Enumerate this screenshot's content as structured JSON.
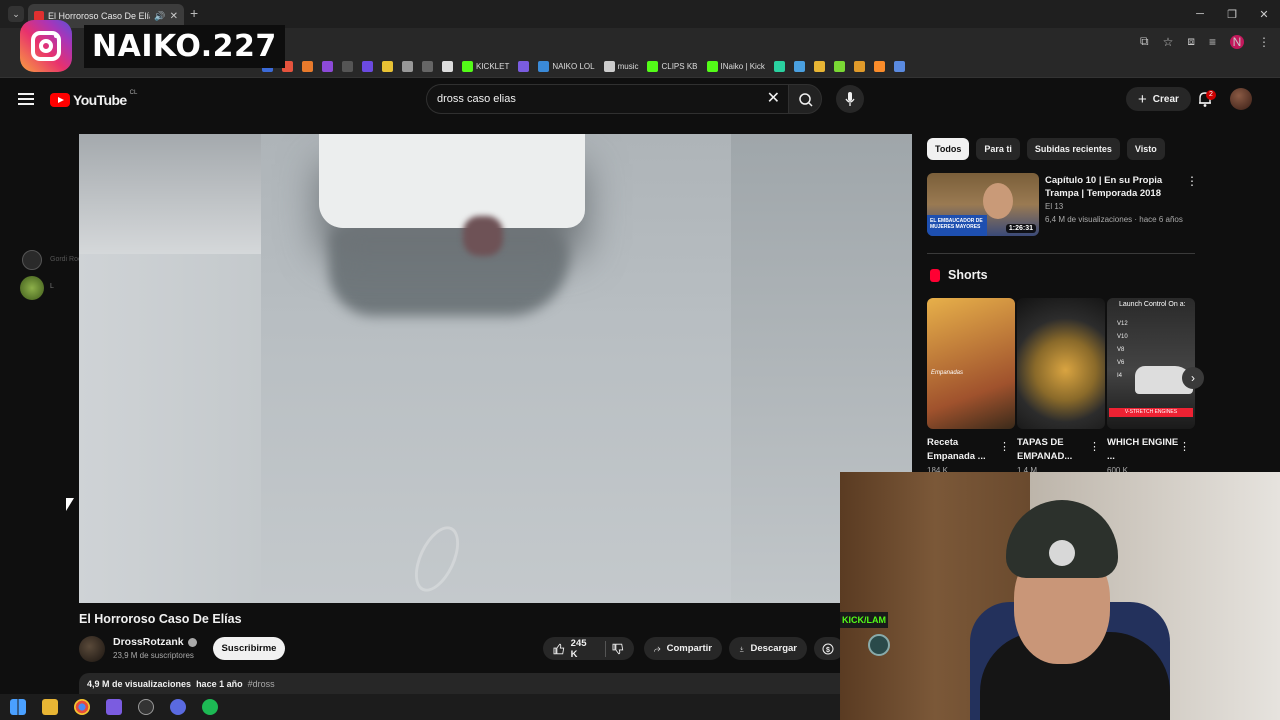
{
  "browser": {
    "tab_title": "El Horroroso Caso De Elías",
    "bookmarks": [
      "KICKLET",
      "NAIKO LOL",
      "music",
      "CLIPS KB",
      "INaiko | Kick"
    ],
    "profile_initial": "N"
  },
  "overlay": {
    "instagram_handle": "NAIKO.227"
  },
  "youtube": {
    "logo_text": "YouTube",
    "country_code": "CL",
    "search_query": "dross caso elias",
    "create_label": "Crear",
    "notifications_count": "2"
  },
  "video": {
    "title": "El Horroroso Caso De Elías",
    "channel": "DrossRotzank",
    "subscribers": "23,9 M de suscriptores",
    "subscribe_label": "Suscribirme",
    "likes": "245 K",
    "share_label": "Compartir",
    "download_label": "Descargar",
    "views": "4,9 M de visualizaciones",
    "age": "hace 1 año",
    "hashtag": "#dross"
  },
  "side_overlay": {
    "label1": "Gordi RockyBrandon",
    "label2": "L"
  },
  "chips": [
    "Todos",
    "Para ti",
    "Subidas recientes",
    "Visto"
  ],
  "recommended": {
    "title": "Capítulo 10 | En su Propia Trampa | Temporada 2018",
    "channel": "El 13",
    "meta": "6,4 M de visualizaciones · hace 6 años",
    "duration": "1:26:31",
    "banner": "EL EMBAUCADOR DE MUJERES MAYORES"
  },
  "shorts": {
    "heading": "Shorts",
    "items": [
      {
        "title": "Receta Empanada ...",
        "views": "184 K",
        "thumb_text": "Empanadas"
      },
      {
        "title": "TAPAS DE EMPANAD...",
        "views": "1,4 M",
        "thumb_text": ""
      },
      {
        "title": "WHICH ENGINE ...",
        "views": "600 K",
        "thumb_text": "Launch Control On a:"
      }
    ],
    "short3_versions": "V12 V10 V8 V6 I4",
    "short3_bar": "V-STRETCH ENGINES"
  },
  "webcam": {
    "kick_label": "KICK/LAM"
  }
}
